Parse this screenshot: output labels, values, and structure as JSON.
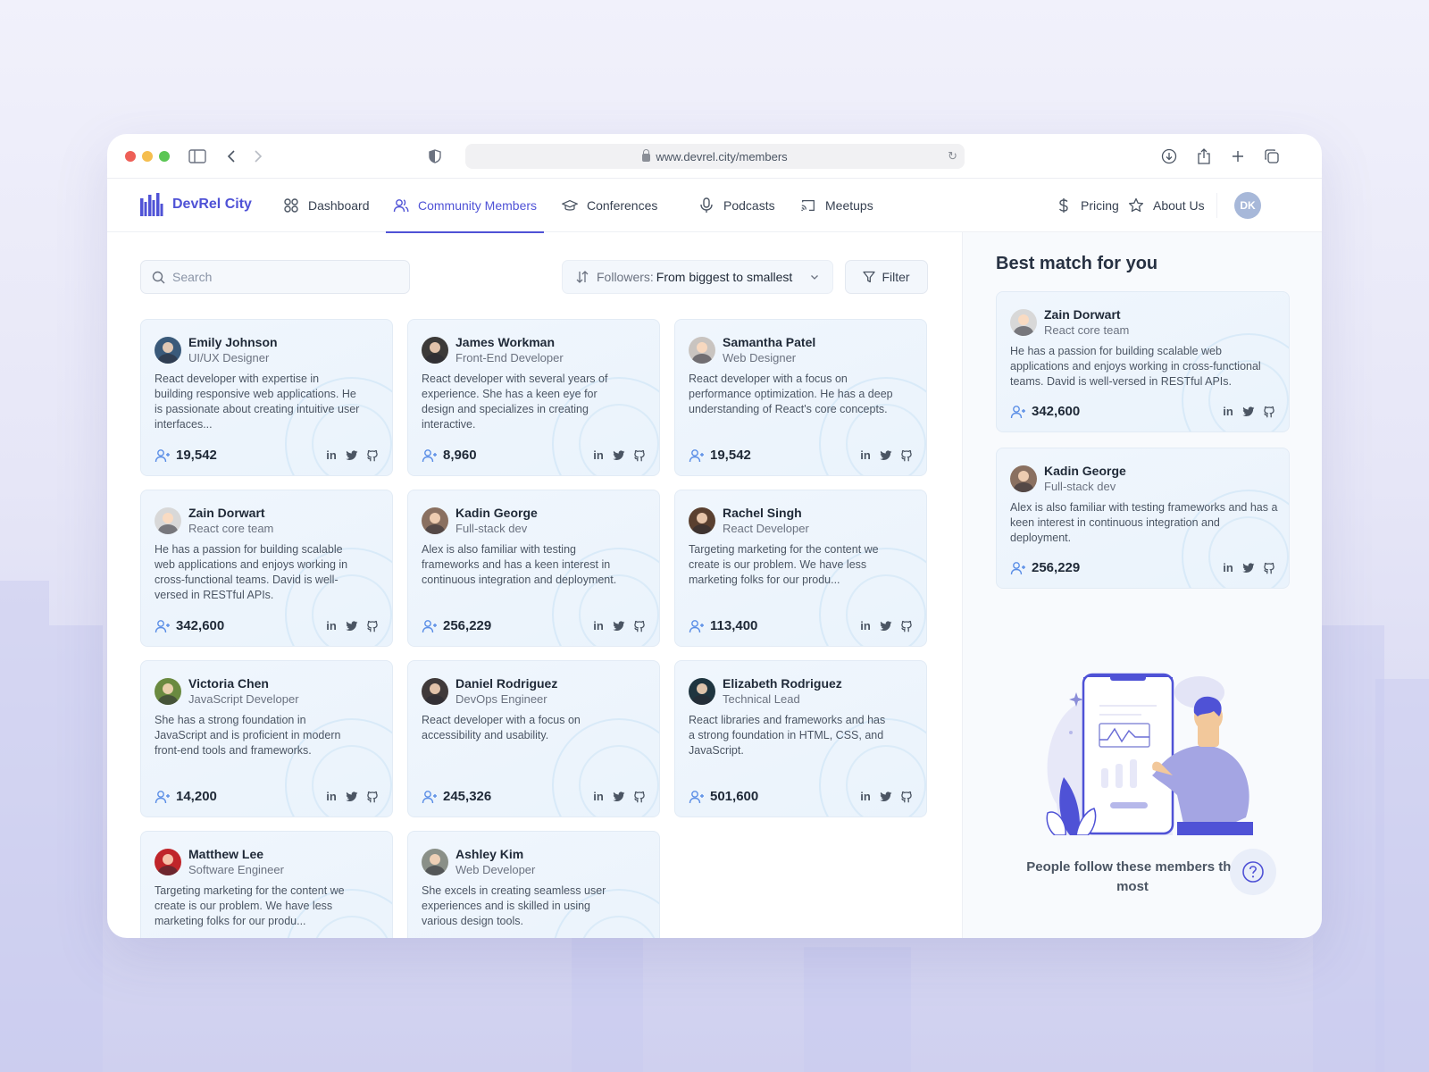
{
  "browser": {
    "url": "www.devrel.city/members"
  },
  "nav": {
    "brand": "DevRel City",
    "items": [
      {
        "label": "Dashboard",
        "icon": "grid-icon"
      },
      {
        "label": "Community Members",
        "icon": "users-icon",
        "active": true
      },
      {
        "label": "Conferences",
        "icon": "graduation-cap-icon"
      },
      {
        "label": "Podcasts",
        "icon": "microphone-icon"
      },
      {
        "label": "Meetups",
        "icon": "cast-icon"
      }
    ],
    "right_items": [
      {
        "label": "Pricing",
        "icon": "dollar-icon"
      },
      {
        "label": "About Us",
        "icon": "star-icon"
      }
    ],
    "user_initials": "DK"
  },
  "toolbar": {
    "search_placeholder": "Search",
    "sort_label": "Followers:",
    "sort_value": "From biggest to smallest",
    "filter_label": "Filter"
  },
  "members": [
    {
      "name": "Emily Johnson",
      "role": "UI/UX Designer",
      "bio": "React developer with expertise in building responsive web applications. He is passionate about creating intuitive user interfaces...",
      "followers": "19,542"
    },
    {
      "name": "James Workman",
      "role": "Front-End Developer",
      "bio": "React developer with several years of experience. She has a keen eye for design and specializes in creating interactive.",
      "followers": "8,960"
    },
    {
      "name": "Samantha Patel",
      "role": "Web Designer",
      "bio": "React developer with a focus on performance optimization. He has a deep understanding of React's core concepts.",
      "followers": "19,542"
    },
    {
      "name": "Zain Dorwart",
      "role": "React core team",
      "bio": "He has a passion for building scalable web applications and enjoys working in cross-functional teams. David is well-versed in RESTful APIs.",
      "followers": "342,600"
    },
    {
      "name": "Kadin George",
      "role": "Full-stack dev",
      "bio": "Alex is also familiar with testing frameworks and has a keen interest in continuous integration and deployment.",
      "followers": "256,229"
    },
    {
      "name": "Rachel Singh",
      "role": "React Developer",
      "bio": "Targeting marketing for the content we create is our problem. We have less marketing folks for our produ...",
      "followers": "113,400"
    },
    {
      "name": "Victoria Chen",
      "role": "JavaScript Developer",
      "bio": "She has a strong foundation in JavaScript and is proficient in modern front-end tools and frameworks.",
      "followers": "14,200"
    },
    {
      "name": "Daniel Rodriguez",
      "role": "DevOps Engineer",
      "bio": "React developer with a focus on accessibility and usability.",
      "followers": "245,326"
    },
    {
      "name": "Elizabeth Rodriguez",
      "role": "Technical Lead",
      "bio": "React libraries and frameworks and has a strong foundation in HTML, CSS, and JavaScript.",
      "followers": "501,600"
    },
    {
      "name": "Matthew Lee",
      "role": "Software Engineer",
      "bio": "Targeting marketing for the content we create is our problem. We have less marketing folks for our produ...",
      "followers": ""
    },
    {
      "name": "Ashley Kim",
      "role": "Web Developer",
      "bio": "She excels in creating seamless user experiences and is skilled in using various design tools.",
      "followers": ""
    }
  ],
  "sidebar": {
    "title": "Best match for you",
    "matches": [
      {
        "name": "Zain Dorwart",
        "role": "React core team",
        "bio": "He has a passion for building scalable web applications and enjoys working in cross-functional teams. David is well-versed in RESTful APIs.",
        "followers": "342,600"
      },
      {
        "name": "Kadin George",
        "role": "Full-stack dev",
        "bio": "Alex is also familiar with testing frameworks and has a keen interest in continuous integration and deployment.",
        "followers": "256,229"
      }
    ],
    "caption": "People follow these members the most"
  },
  "colors": {
    "accent": "#4f52d6",
    "follower_icon": "#5b8ee6",
    "card_bg": "#eef5fd"
  }
}
